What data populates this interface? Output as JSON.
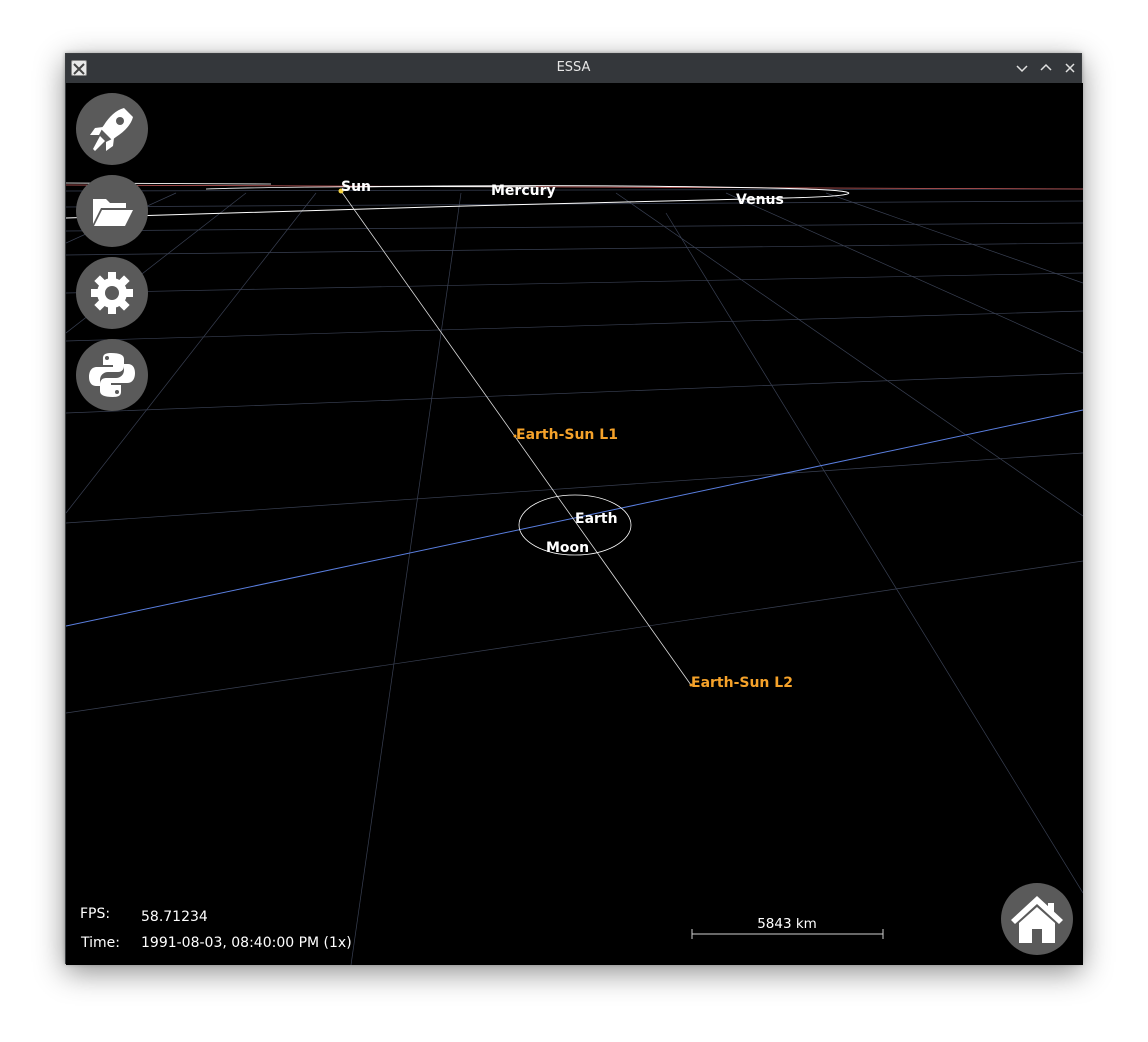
{
  "window": {
    "title": "ESSA"
  },
  "toolbar": {
    "buttons": [
      {
        "icon": "rocket-icon",
        "action": "create-object"
      },
      {
        "icon": "folder-open-icon",
        "action": "open-file"
      },
      {
        "icon": "gear-icon",
        "action": "settings"
      },
      {
        "icon": "python-icon",
        "action": "python-console"
      }
    ],
    "home_icon": "home-icon"
  },
  "scene": {
    "bodies": [
      {
        "name": "Sun",
        "color": "#ffffff"
      },
      {
        "name": "Mercury",
        "color": "#ffffff"
      },
      {
        "name": "Venus",
        "color": "#ffffff"
      },
      {
        "name": "Earth-Sun L1",
        "color": "#f5a22a"
      },
      {
        "name": "Earth",
        "color": "#ffffff"
      },
      {
        "name": "Moon",
        "color": "#ffffff"
      },
      {
        "name": "Earth-Sun L2",
        "color": "#f5a22a"
      }
    ]
  },
  "hud": {
    "fps_label": "FPS:",
    "fps_value": "58.71234",
    "time_label": "Time:",
    "time_value": "1991-08-03, 08:40:00 PM (1x)",
    "scale_label": "5843 km"
  },
  "colors": {
    "background": "#000000",
    "grid": "#7f8fb8",
    "orbit_earth": "#5a7fe0",
    "lagrange": "#f5a22a",
    "button_bg": "#5a5a5a",
    "titlebar": "#34373b"
  }
}
